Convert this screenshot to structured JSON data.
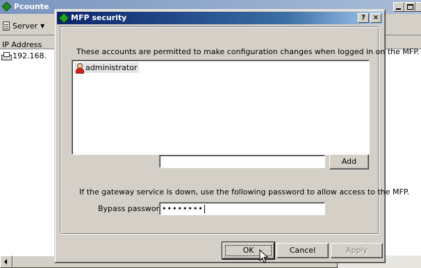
{
  "main_window": {
    "title": "Pcounte",
    "toolbar": {
      "server_label": "Server"
    },
    "list": {
      "column_header": "IP Address",
      "rows": [
        {
          "ip": "192.168."
        }
      ]
    }
  },
  "dialog": {
    "title": "MFP security",
    "title_buttons": {
      "help": "?",
      "close": "×"
    },
    "accounts_label": "These accounts are permitted to make configuration changes when logged in on the MFP.",
    "accounts": [
      {
        "name": "administrator",
        "icon": "user-icon"
      }
    ],
    "new_account_value": "",
    "add_button": "Add",
    "gateway_label": "If the gateway service is down, use the following password to allow access to the MFP.",
    "bypass_label": "Bypass password:",
    "bypass_value": "••••••••",
    "buttons": {
      "ok": "OK",
      "cancel": "Cancel",
      "apply": "Apply"
    }
  },
  "colors": {
    "dialog_title_start": "#0a246a",
    "dialog_title_end": "#a6caf0",
    "face": "#d4d0c8"
  }
}
